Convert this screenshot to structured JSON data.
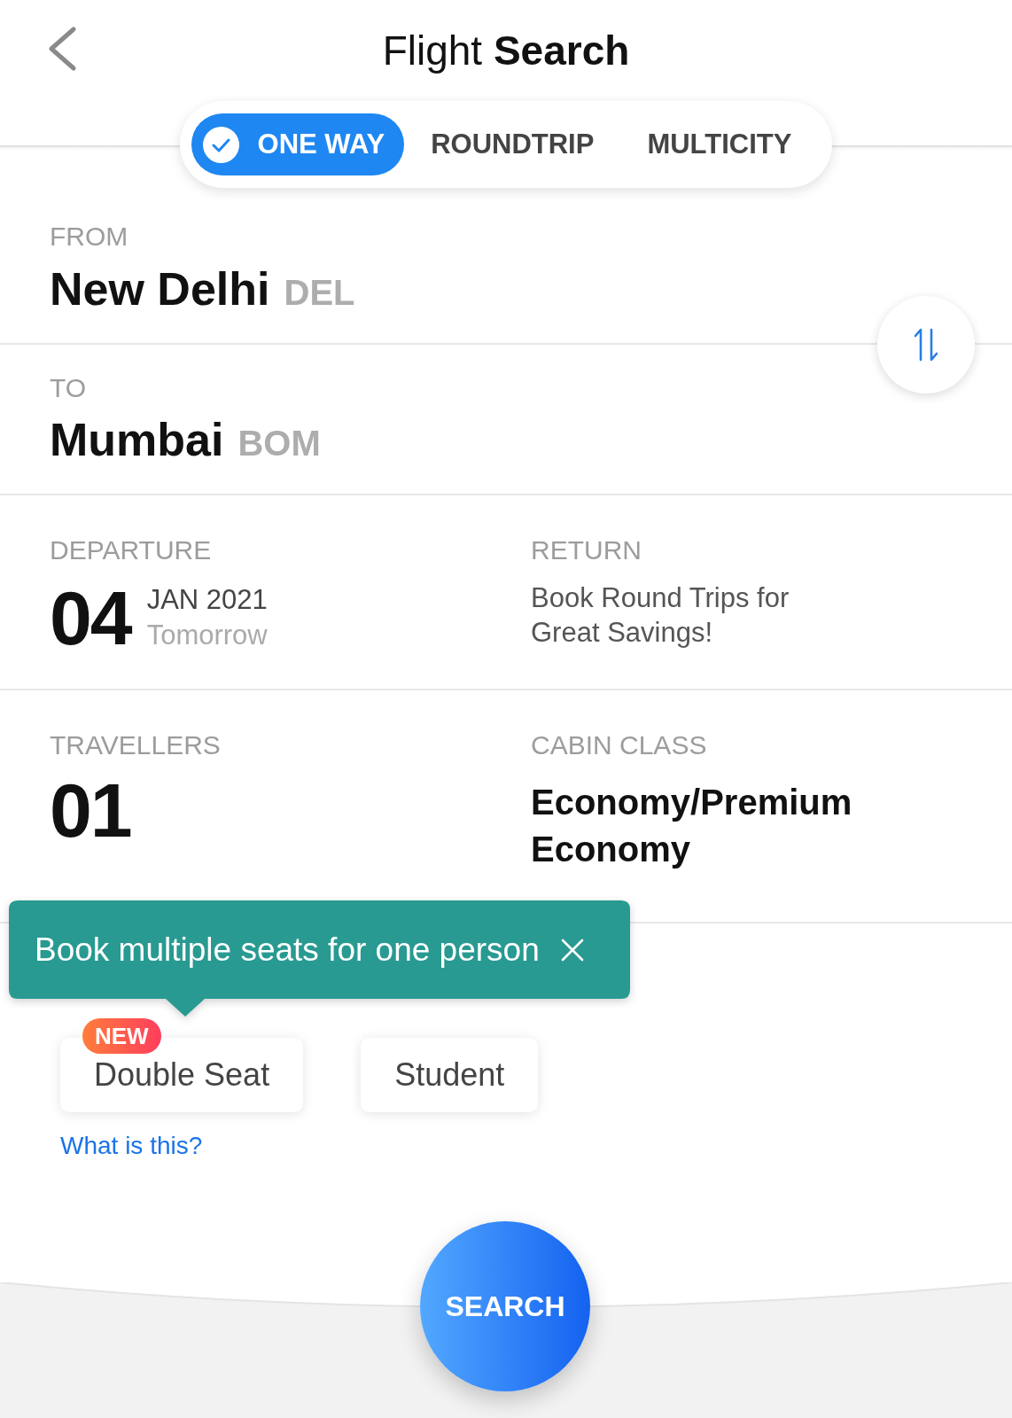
{
  "header": {
    "title": "Flight **Search**"
  },
  "trip_types": [
    {
      "label": "ONE WAY",
      "selected": true
    },
    {
      "label": "ROUNDTRIP",
      "selected": false
    },
    {
      "label": "MULTICITY",
      "selected": false
    }
  ],
  "from": {
    "label": "FROM",
    "city": "New Delhi",
    "code": "DEL"
  },
  "to": {
    "label": "TO",
    "city": "Mumbai",
    "code": "BOM"
  },
  "departure": {
    "label": "DEPARTURE",
    "day": "04",
    "month_year": "JAN 2021",
    "note": "Tomorrow"
  },
  "return": {
    "label": "RETURN",
    "message": "Book Round Trips for Great Savings!"
  },
  "travellers": {
    "label": "TRAVELLERS",
    "count": "01"
  },
  "cabin_class": {
    "label": "CABIN CLASS",
    "value": "Economy/Premium Economy"
  },
  "tooltip": {
    "text": "Book multiple seats for one person"
  },
  "fare_options": [
    {
      "label": "Double Seat",
      "badge": "NEW",
      "link": "What is this?"
    },
    {
      "label": "Student"
    }
  ],
  "search_button": {
    "label": "SEARCH"
  }
}
